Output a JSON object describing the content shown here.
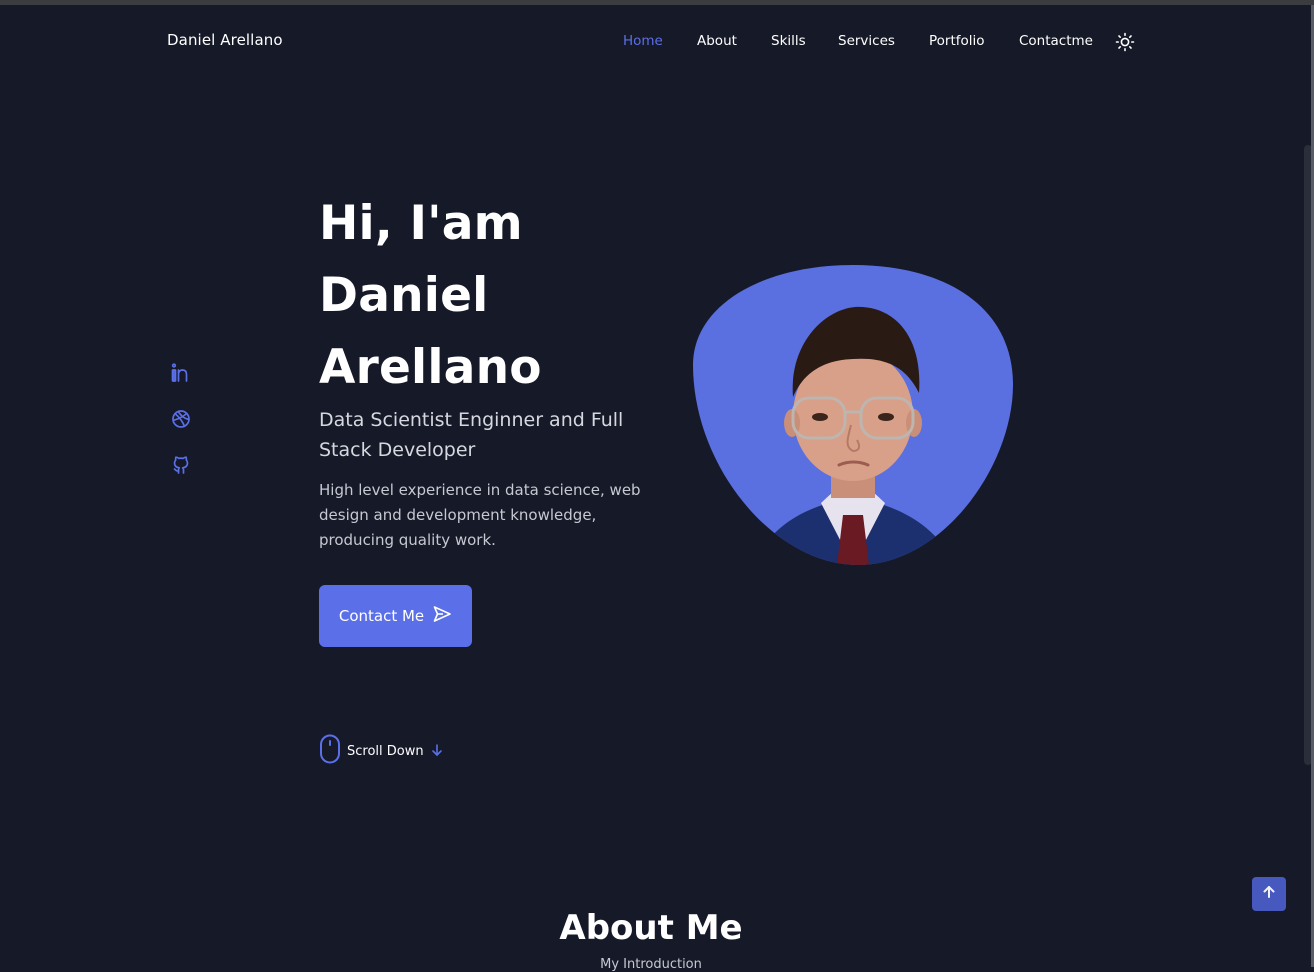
{
  "header": {
    "logo": "Daniel Arellano",
    "nav": [
      {
        "label": "Home",
        "active": true
      },
      {
        "label": "About",
        "active": false
      },
      {
        "label": "Skills",
        "active": false
      },
      {
        "label": "Services",
        "active": false
      },
      {
        "label": "Portfolio",
        "active": false
      },
      {
        "label": "Contactme",
        "active": false
      }
    ],
    "theme_icon": "sun-icon"
  },
  "social": [
    {
      "icon": "linkedin-icon"
    },
    {
      "icon": "dribbble-icon"
    },
    {
      "icon": "github-icon"
    }
  ],
  "hero": {
    "title_line1": "Hi, I'am",
    "title_line2": "Daniel",
    "title_line3": "Arellano",
    "subtitle": "Data Scientist Enginner and Full Stack Developer",
    "description": "High level experience in data science, web design and development knowledge, producing quality work.",
    "contact_button": "Contact Me",
    "contact_icon": "send-icon",
    "scroll_down": "Scroll Down",
    "scroll_icons": [
      "mouse-icon",
      "arrow-down-icon"
    ]
  },
  "about": {
    "title": "About Me",
    "subtitle": "My Introduction"
  },
  "scroll_top_icon": "arrow-up-icon",
  "colors": {
    "background": "#161928",
    "accent": "#5a6fe8",
    "text": "#ffffff",
    "muted": "#c6c8d2"
  }
}
